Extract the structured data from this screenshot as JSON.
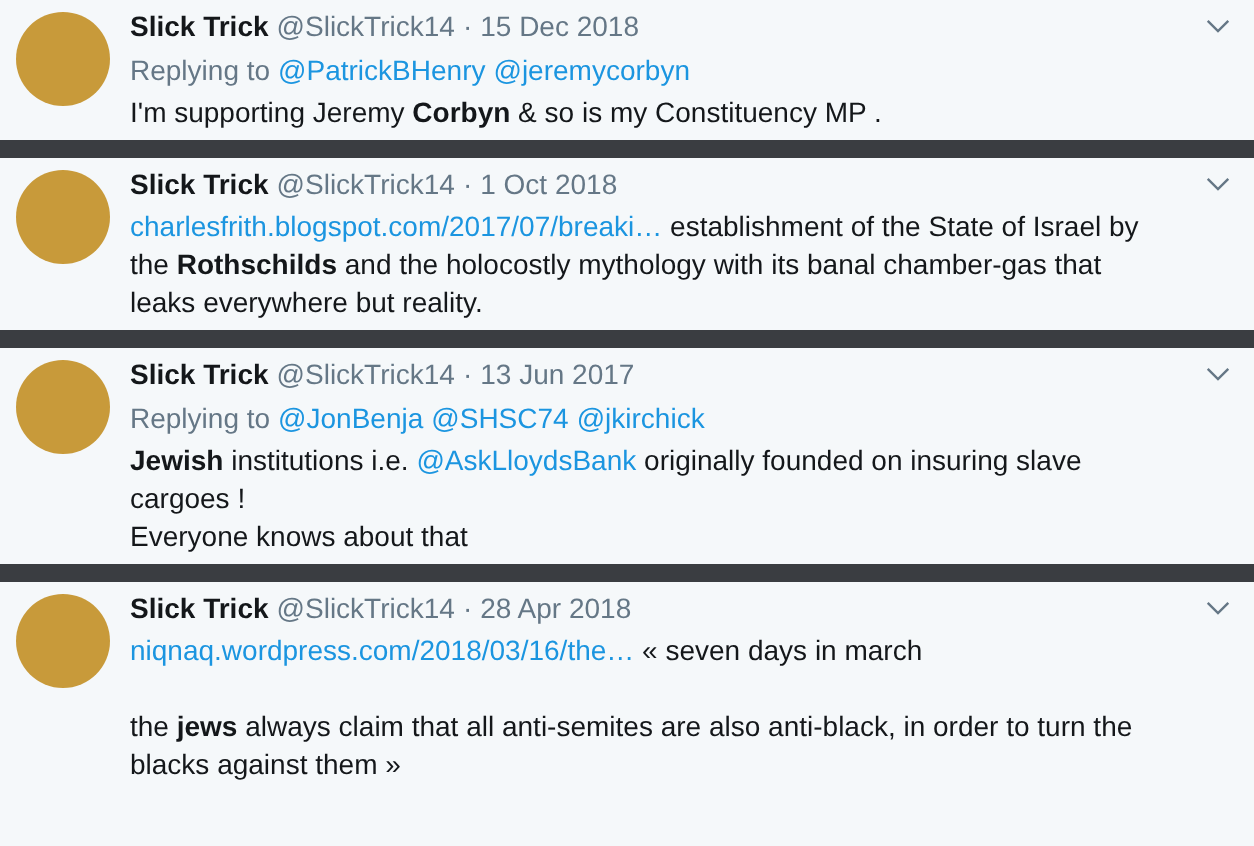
{
  "tweets": [
    {
      "name": "Slick Trick",
      "handle": "@SlickTrick14",
      "separator": "·",
      "date": "15 Dec 2018",
      "reply_label": "Replying to",
      "replying_to": [
        "@PatrickBHenry",
        "@jeremycorbyn"
      ],
      "paragraphs": [
        {
          "blank_line_before": false,
          "segments": [
            {
              "kind": "text",
              "text": "I'm supporting Jeremy **Corbyn** & so is my Constituency MP ."
            }
          ]
        }
      ]
    },
    {
      "name": "Slick Trick",
      "handle": "@SlickTrick14",
      "separator": "·",
      "date": "1 Oct 2018",
      "paragraphs": [
        {
          "blank_line_before": false,
          "segments": [
            {
              "kind": "link",
              "text": "charlesfrith.blogspot.com/2017/07/breaki…"
            },
            {
              "kind": "text",
              "text": " establishment of the State of Israel by the **Rothschilds** and the holocostly mythology with its banal chamber-gas that leaks everywhere but reality."
            }
          ]
        }
      ]
    },
    {
      "name": "Slick Trick",
      "handle": "@SlickTrick14",
      "separator": "·",
      "date": "13 Jun 2017",
      "reply_label": "Replying to",
      "replying_to": [
        "@JonBenja",
        "@SHSC74",
        "@jkirchick"
      ],
      "paragraphs": [
        {
          "blank_line_before": false,
          "segments": [
            {
              "kind": "text",
              "text": "**Jewish** institutions i.e. "
            },
            {
              "kind": "link",
              "text": "@AskLloydsBank"
            },
            {
              "kind": "text",
              "text": " originally founded on insuring slave cargoes !"
            }
          ]
        },
        {
          "blank_line_before": false,
          "segments": [
            {
              "kind": "text",
              "text": "Everyone knows about that"
            }
          ]
        }
      ]
    },
    {
      "name": "Slick Trick",
      "handle": "@SlickTrick14",
      "separator": "·",
      "date": "28 Apr 2018",
      "paragraphs": [
        {
          "blank_line_before": false,
          "segments": [
            {
              "kind": "link",
              "text": "niqnaq.wordpress.com/2018/03/16/the…"
            },
            {
              "kind": "text",
              "text": " « seven days in march"
            }
          ]
        },
        {
          "blank_line_before": true,
          "segments": [
            {
              "kind": "text",
              "text": "the **jews** always claim that all anti-semites are also anti-black, in order to turn the blacks against them »"
            }
          ]
        }
      ]
    }
  ]
}
